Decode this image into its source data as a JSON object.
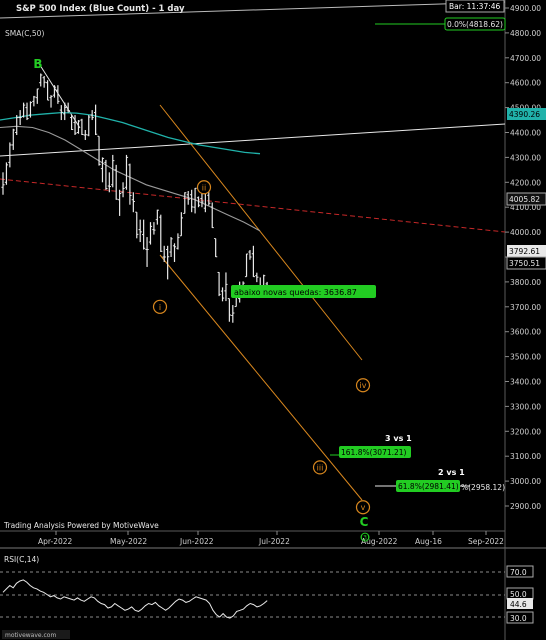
{
  "header": {
    "title": "S&P 500 Index (Blue Count) - 1 day",
    "bar_label": "Bar: 11:37:46",
    "sma_label": "SMA(C,50)",
    "powered_by": "Trading Analysis Powered by MotiveWave",
    "rsi_label": "RSI(C,14)",
    "site": "motivewave.com"
  },
  "colors": {
    "background": "#000000",
    "price_bar": "#e8e8e8",
    "sma_short": "#20b2aa",
    "sma_long": "#9a9a9a",
    "channel": "#d8871e",
    "wave_label": "#d8871e",
    "wave_green": "#22cc22",
    "target_box": "#22cc22",
    "redline": "#c62828"
  },
  "chart_data": {
    "type": "candlestick",
    "title": "S&P 500 Index (Blue Count) - 1 day",
    "y_ticks": [
      2900,
      3000,
      3100,
      3200,
      3300,
      3400,
      3500,
      3600,
      3700,
      3800,
      3900,
      4000,
      4100,
      4200,
      4300,
      4400,
      4500,
      4600,
      4700,
      4800,
      4900
    ],
    "y_tick_labels": [
      "2900.00",
      "3000.00",
      "3100.00",
      "3200.00",
      "3300.00",
      "3400.00",
      "3500.00",
      "3600.00",
      "3700.00",
      "3800.00",
      "3900.00",
      "4000.00",
      "4100.00",
      "4200.00",
      "4300.00",
      "4400.00",
      "4500.00",
      "4600.00",
      "4700.00",
      "4800.00",
      "4900.00"
    ],
    "x_labels": [
      "Apr-2022",
      "May-2022",
      "Jun-2022",
      "Jul-2022",
      "Aug-2022",
      "Aug-16",
      "Sep-2022"
    ],
    "ylim": [
      2850,
      4945
    ],
    "price_labels": [
      "4390.26",
      "4005.82",
      "3792.61",
      "3750.51"
    ],
    "top_label": "0.0%(4818.62)",
    "wave_labels": [
      {
        "label": "B",
        "price": 4660
      },
      {
        "label": "ii",
        "price": 4180
      },
      {
        "label": "i",
        "price": 3700
      },
      {
        "label": "iv",
        "price": 3385
      },
      {
        "label": "iii",
        "price": 3055
      },
      {
        "label": "v",
        "price": 2895
      },
      {
        "label": "C",
        "price": 2820
      },
      {
        "label": "(3)",
        "price": 2775
      }
    ],
    "annotations": [
      {
        "text": "abaixo novas quedas: 3636.87",
        "price": 3636.87
      },
      {
        "text": "161.8%(3071.21)",
        "price": 3071.21
      },
      {
        "text": "3 vs 1",
        "price": 3071.21
      },
      {
        "text": "61.8%(2981.41)",
        "price": 2981.41
      },
      {
        "text": "2 vs 1",
        "price": 2981.41
      },
      {
        "text": "%(2958.12)",
        "price": 2958.12
      }
    ],
    "ohlc": [
      {
        "d": "2022-03-14",
        "o": 4180,
        "h": 4240,
        "l": 4150,
        "c": 4190
      },
      {
        "d": "2022-03-15",
        "o": 4200,
        "h": 4280,
        "l": 4190,
        "c": 4270
      },
      {
        "d": "2022-03-16",
        "o": 4280,
        "h": 4360,
        "l": 4260,
        "c": 4350
      },
      {
        "d": "2022-03-17",
        "o": 4350,
        "h": 4415,
        "l": 4330,
        "c": 4410
      },
      {
        "d": "2022-03-18",
        "o": 4400,
        "h": 4470,
        "l": 4390,
        "c": 4460
      },
      {
        "d": "2022-03-21",
        "o": 4460,
        "h": 4490,
        "l": 4430,
        "c": 4460
      },
      {
        "d": "2022-03-22",
        "o": 4465,
        "h": 4520,
        "l": 4460,
        "c": 4510
      },
      {
        "d": "2022-03-23",
        "o": 4500,
        "h": 4520,
        "l": 4450,
        "c": 4456
      },
      {
        "d": "2022-03-24",
        "o": 4470,
        "h": 4525,
        "l": 4460,
        "c": 4520
      },
      {
        "d": "2022-03-25",
        "o": 4525,
        "h": 4547,
        "l": 4505,
        "c": 4543
      },
      {
        "d": "2022-03-28",
        "o": 4540,
        "h": 4576,
        "l": 4515,
        "c": 4575
      },
      {
        "d": "2022-03-29",
        "o": 4600,
        "h": 4637,
        "l": 4585,
        "c": 4631
      },
      {
        "d": "2022-03-30",
        "o": 4620,
        "h": 4627,
        "l": 4580,
        "c": 4602
      },
      {
        "d": "2022-03-31",
        "o": 4600,
        "h": 4610,
        "l": 4530,
        "c": 4530
      },
      {
        "d": "2022-04-01",
        "o": 4540,
        "h": 4550,
        "l": 4500,
        "c": 4545
      },
      {
        "d": "2022-04-04",
        "o": 4550,
        "h": 4590,
        "l": 4540,
        "c": 4582
      },
      {
        "d": "2022-04-05",
        "o": 4570,
        "h": 4590,
        "l": 4515,
        "c": 4525
      },
      {
        "d": "2022-04-06",
        "o": 4490,
        "h": 4510,
        "l": 4450,
        "c": 4481
      },
      {
        "d": "2022-04-07",
        "o": 4475,
        "h": 4520,
        "l": 4450,
        "c": 4500
      },
      {
        "d": "2022-04-08",
        "o": 4490,
        "h": 4520,
        "l": 4480,
        "c": 4488
      },
      {
        "d": "2022-04-11",
        "o": 4460,
        "h": 4470,
        "l": 4410,
        "c": 4412
      },
      {
        "d": "2022-04-12",
        "o": 4440,
        "h": 4470,
        "l": 4390,
        "c": 4397
      },
      {
        "d": "2022-04-13",
        "o": 4400,
        "h": 4450,
        "l": 4395,
        "c": 4446
      },
      {
        "d": "2022-04-14",
        "o": 4450,
        "h": 4455,
        "l": 4390,
        "c": 4392
      },
      {
        "d": "2022-04-18",
        "o": 4390,
        "h": 4410,
        "l": 4370,
        "c": 4391
      },
      {
        "d": "2022-04-19",
        "o": 4390,
        "h": 4470,
        "l": 4385,
        "c": 4462
      },
      {
        "d": "2022-04-20",
        "o": 4470,
        "h": 4490,
        "l": 4450,
        "c": 4460
      },
      {
        "d": "2022-04-21",
        "o": 4480,
        "h": 4512,
        "l": 4390,
        "c": 4393
      },
      {
        "d": "2022-04-22",
        "o": 4385,
        "h": 4385,
        "l": 4267,
        "c": 4272
      },
      {
        "d": "2022-04-25",
        "o": 4255,
        "h": 4300,
        "l": 4200,
        "c": 4296
      },
      {
        "d": "2022-04-26",
        "o": 4280,
        "h": 4290,
        "l": 4170,
        "c": 4175
      },
      {
        "d": "2022-04-27",
        "o": 4185,
        "h": 4240,
        "l": 4160,
        "c": 4183
      },
      {
        "d": "2022-04-28",
        "o": 4190,
        "h": 4310,
        "l": 4180,
        "c": 4287
      },
      {
        "d": "2022-04-29",
        "o": 4250,
        "h": 4270,
        "l": 4130,
        "c": 4132
      },
      {
        "d": "2022-05-02",
        "o": 4130,
        "h": 4170,
        "l": 4065,
        "c": 4155
      },
      {
        "d": "2022-05-03",
        "o": 4160,
        "h": 4200,
        "l": 4140,
        "c": 4175
      },
      {
        "d": "2022-05-04",
        "o": 4180,
        "h": 4310,
        "l": 4170,
        "c": 4300
      },
      {
        "d": "2022-05-05",
        "o": 4270,
        "h": 4275,
        "l": 4110,
        "c": 4147
      },
      {
        "d": "2022-05-06",
        "o": 4130,
        "h": 4160,
        "l": 4080,
        "c": 4123
      },
      {
        "d": "2022-05-09",
        "o": 4080,
        "h": 4080,
        "l": 3975,
        "c": 3991
      },
      {
        "d": "2022-05-10",
        "o": 4010,
        "h": 4050,
        "l": 3960,
        "c": 4001
      },
      {
        "d": "2022-05-11",
        "o": 3990,
        "h": 4050,
        "l": 3930,
        "c": 3935
      },
      {
        "d": "2022-05-12",
        "o": 3930,
        "h": 3980,
        "l": 3860,
        "c": 3930
      },
      {
        "d": "2022-05-13",
        "o": 3960,
        "h": 4040,
        "l": 3950,
        "c": 4023
      },
      {
        "d": "2022-05-16",
        "o": 4010,
        "h": 4040,
        "l": 3990,
        "c": 4008
      },
      {
        "d": "2022-05-17",
        "o": 4050,
        "h": 4090,
        "l": 4030,
        "c": 4088
      },
      {
        "d": "2022-05-18",
        "o": 4060,
        "h": 4070,
        "l": 3920,
        "c": 3923
      },
      {
        "d": "2022-05-19",
        "o": 3900,
        "h": 3945,
        "l": 3880,
        "c": 3900
      },
      {
        "d": "2022-05-20",
        "o": 3930,
        "h": 3945,
        "l": 3810,
        "c": 3901
      },
      {
        "d": "2022-05-23",
        "o": 3920,
        "h": 3980,
        "l": 3900,
        "c": 3973
      },
      {
        "d": "2022-05-24",
        "o": 3945,
        "h": 3955,
        "l": 3880,
        "c": 3941
      },
      {
        "d": "2022-05-25",
        "o": 3935,
        "h": 3995,
        "l": 3930,
        "c": 3978
      },
      {
        "d": "2022-05-26",
        "o": 3985,
        "h": 4080,
        "l": 3985,
        "c": 4057
      },
      {
        "d": "2022-05-27",
        "o": 4075,
        "h": 4160,
        "l": 4075,
        "c": 4158
      },
      {
        "d": "2022-05-31",
        "o": 4150,
        "h": 4165,
        "l": 4110,
        "c": 4132
      },
      {
        "d": "2022-06-01",
        "o": 4150,
        "h": 4170,
        "l": 4080,
        "c": 4101
      },
      {
        "d": "2022-06-02",
        "o": 4100,
        "h": 4177,
        "l": 4075,
        "c": 4176
      },
      {
        "d": "2022-06-03",
        "o": 4138,
        "h": 4143,
        "l": 4100,
        "c": 4108
      },
      {
        "d": "2022-06-06",
        "o": 4135,
        "h": 4170,
        "l": 4100,
        "c": 4121
      },
      {
        "d": "2022-06-07",
        "o": 4096,
        "h": 4164,
        "l": 4080,
        "c": 4161
      },
      {
        "d": "2022-06-08",
        "o": 4148,
        "h": 4160,
        "l": 4107,
        "c": 4116
      },
      {
        "d": "2022-06-09",
        "o": 4101,
        "h": 4119,
        "l": 4017,
        "c": 4018
      },
      {
        "d": "2022-06-10",
        "o": 3974,
        "h": 3974,
        "l": 3900,
        "c": 3901
      },
      {
        "d": "2022-06-13",
        "o": 3838,
        "h": 3839,
        "l": 3743,
        "c": 3750
      },
      {
        "d": "2022-06-14",
        "o": 3763,
        "h": 3778,
        "l": 3722,
        "c": 3735
      },
      {
        "d": "2022-06-15",
        "o": 3764,
        "h": 3838,
        "l": 3723,
        "c": 3790
      },
      {
        "d": "2022-06-16",
        "o": 3733,
        "h": 3733,
        "l": 3640,
        "c": 3667
      },
      {
        "d": "2022-06-17",
        "o": 3665,
        "h": 3707,
        "l": 3636,
        "c": 3675
      },
      {
        "d": "2022-06-21",
        "o": 3701,
        "h": 3779,
        "l": 3701,
        "c": 3765
      },
      {
        "d": "2022-06-22",
        "o": 3733,
        "h": 3801,
        "l": 3717,
        "c": 3760
      },
      {
        "d": "2022-06-23",
        "o": 3774,
        "h": 3802,
        "l": 3743,
        "c": 3795
      },
      {
        "d": "2022-06-24",
        "o": 3821,
        "h": 3913,
        "l": 3821,
        "c": 3912
      },
      {
        "d": "2022-06-27",
        "o": 3920,
        "h": 3928,
        "l": 3889,
        "c": 3900
      },
      {
        "d": "2022-06-28",
        "o": 3913,
        "h": 3945,
        "l": 3820,
        "c": 3821
      },
      {
        "d": "2022-06-29",
        "o": 3825,
        "h": 3837,
        "l": 3799,
        "c": 3819
      },
      {
        "d": "2022-06-30",
        "o": 3785,
        "h": 3818,
        "l": 3738,
        "c": 3785
      },
      {
        "d": "2022-07-01",
        "o": 3782,
        "h": 3829,
        "l": 3752,
        "c": 3825
      },
      {
        "d": "2022-07-05",
        "o": 3792,
        "h": 3800,
        "l": 3742,
        "c": 3751
      }
    ],
    "sma_short_label": "SMA(C,50)",
    "sma_short": [
      4450,
      4460,
      4470,
      4475,
      4480,
      4478,
      4470,
      4455,
      4440,
      4420,
      4400,
      4380,
      4365,
      4350,
      4340,
      4330,
      4320,
      4315
    ],
    "sma_long": [
      4420,
      4425,
      4420,
      4400,
      4370,
      4330,
      4290,
      4250,
      4220,
      4190,
      4170,
      4150,
      4130,
      4100,
      4070,
      4040,
      4005
    ],
    "rsi": {
      "label": "RSI(C,14)",
      "levels": [
        "70.0",
        "50.0",
        "30.0"
      ],
      "value_label": "44.6",
      "values": [
        52,
        55,
        58,
        56,
        60,
        62,
        63,
        61,
        58,
        56,
        55,
        53,
        52,
        50,
        48,
        49,
        47,
        46,
        48,
        47,
        46,
        45,
        47,
        45,
        44,
        46,
        48,
        47,
        44,
        42,
        41,
        38,
        39,
        42,
        40,
        38,
        36,
        37,
        39,
        36,
        35,
        37,
        40,
        42,
        41,
        43,
        40,
        38,
        36,
        38,
        41,
        44,
        46,
        45,
        43,
        44,
        46,
        48,
        47,
        46,
        45,
        42,
        36,
        32,
        30,
        33,
        30,
        29,
        31,
        35,
        36,
        37,
        40,
        42,
        41,
        39,
        40,
        42,
        44.6
      ]
    }
  }
}
